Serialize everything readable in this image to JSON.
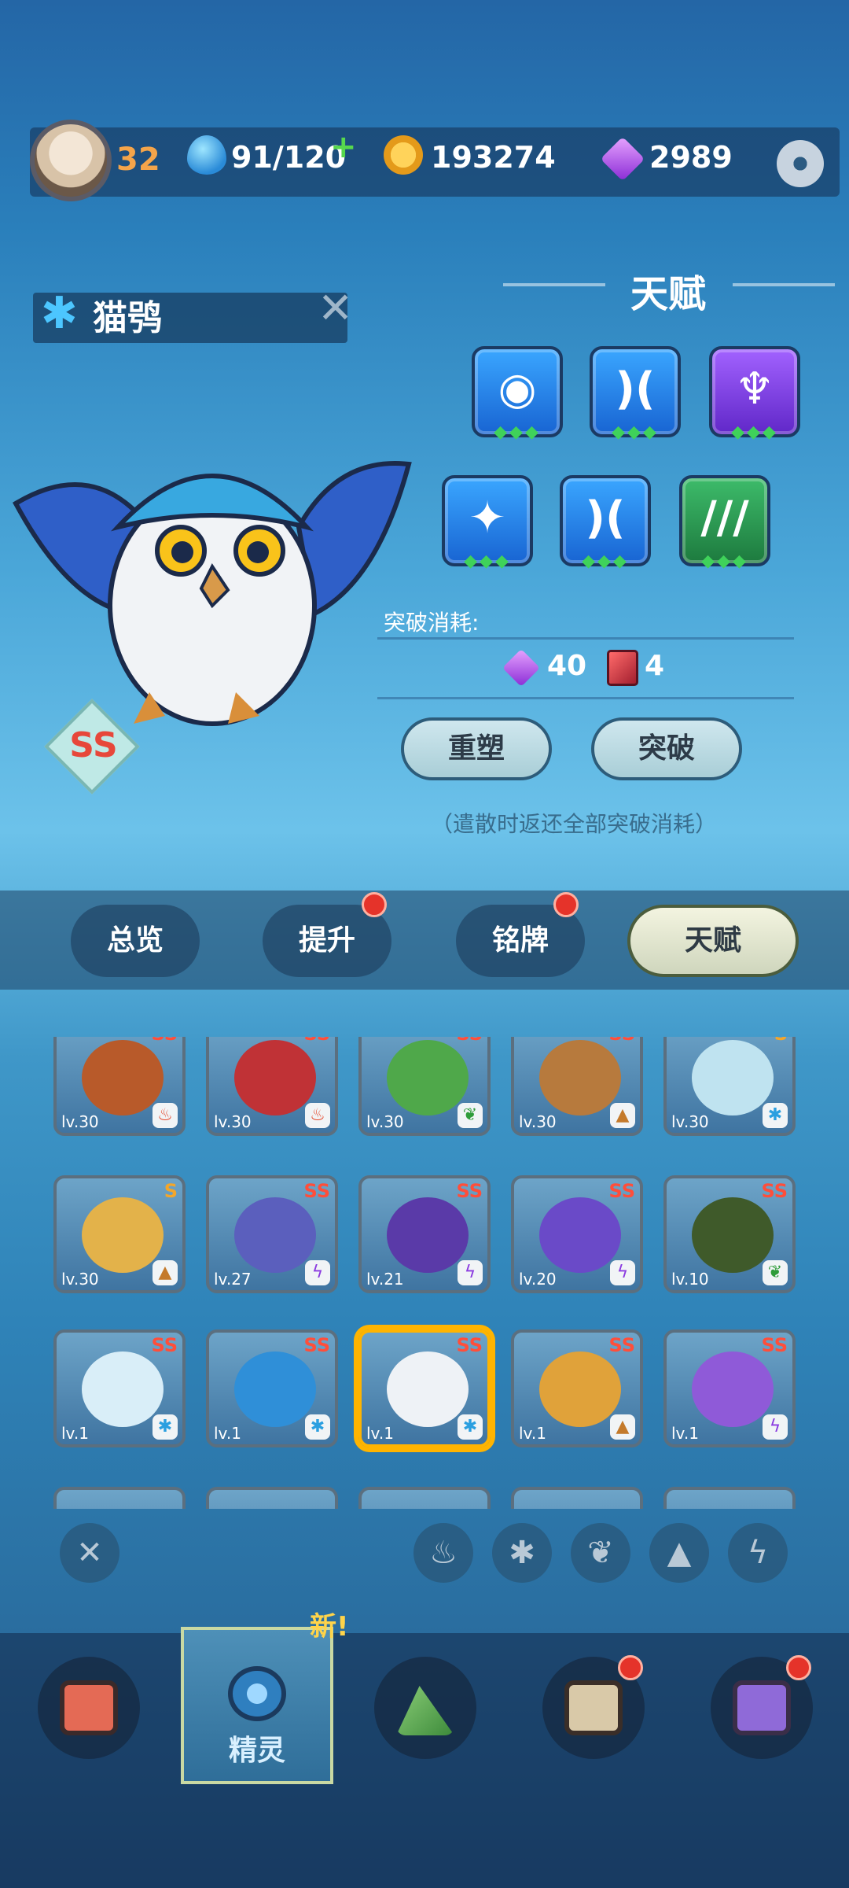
{
  "player": {
    "level": "32"
  },
  "resources": {
    "energy": "91/120",
    "coins": "193274",
    "gems": "2989"
  },
  "monster": {
    "name": "猫鸮",
    "grade": "SS"
  },
  "talent": {
    "title": "天赋",
    "breakthrough_cost_label": "突破消耗:",
    "cost_gems": "40",
    "cost_books": "4",
    "reshape_label": "重塑",
    "breakthrough_label": "突破",
    "hint": "（遣散时返还全部突破消耗）"
  },
  "tabs": [
    {
      "label": "总览"
    },
    {
      "label": "提升"
    },
    {
      "label": "铭牌"
    },
    {
      "label": "天赋"
    }
  ],
  "grid": {
    "row1": [
      "lv.30",
      "lv.30",
      "lv.30",
      "lv.30",
      "lv.30"
    ],
    "row2": [
      "lv.30",
      "lv.27",
      "lv.21",
      "lv.20",
      "lv.10"
    ],
    "row3": [
      "lv.1",
      "lv.1",
      "lv.1",
      "lv.1",
      "lv.1"
    ],
    "rank_ss": "SS",
    "rank_s": "S"
  },
  "nav": {
    "spirit_label": "精灵",
    "new_tag": "新!"
  },
  "colors": {
    "accent": "#f4a44a",
    "badge_red": "#e5332a"
  }
}
